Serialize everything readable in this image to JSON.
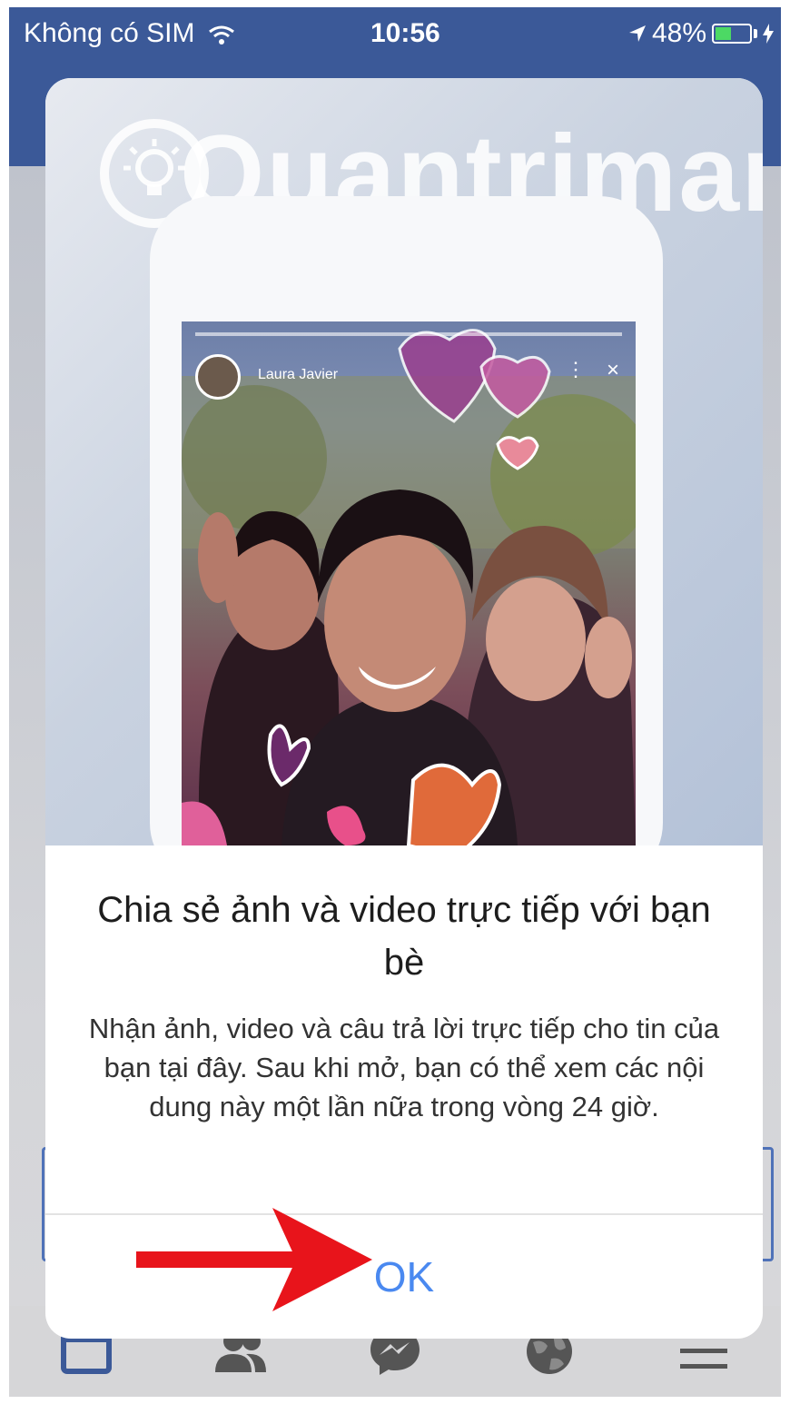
{
  "status": {
    "carrier": "Không có SIM",
    "time": "10:56",
    "battery": "48%",
    "battery_level": 0.48
  },
  "watermark": "Quantrimang",
  "story": {
    "user_name": "Laura Javier",
    "close_label": "×",
    "more_label": "⋮"
  },
  "dialog": {
    "title": "Chia sẻ ảnh và video trực tiếp với bạn bè",
    "description": "Nhận ảnh, video và câu trả lời trực tiếp cho tin của bạn tại đây. Sau khi mở, bạn có thể xem các nội dung này một lần nữa trong vòng 24 giờ.",
    "ok_label": "OK"
  },
  "tabs": [
    {
      "name": "news-feed-icon"
    },
    {
      "name": "friends-icon"
    },
    {
      "name": "messenger-icon"
    },
    {
      "name": "globe-icon"
    },
    {
      "name": "menu-icon"
    }
  ],
  "colors": {
    "facebook_blue": "#3b5998",
    "ok_blue": "#4a89f0",
    "annotation_red": "#e8141b"
  }
}
